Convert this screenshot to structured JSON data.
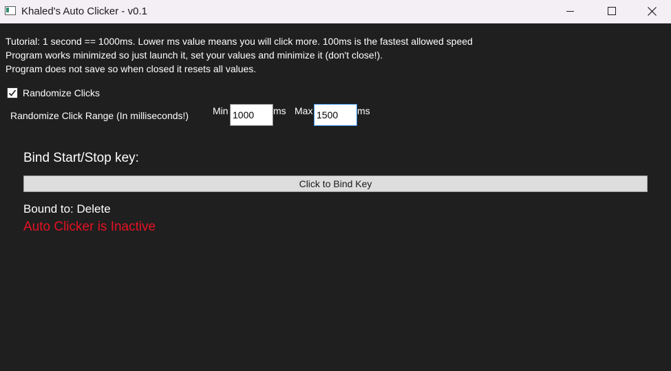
{
  "window": {
    "title": "Khaled's Auto Clicker - v0.1"
  },
  "tutorial": {
    "line1": "Tutorial: 1 second == 1000ms. Lower ms value means you will click more. 100ms is the fastest allowed speed",
    "line2": "Program works minimized so just launch it, set your values and minimize it (don't close!).",
    "line3": "Program does not save so when closed it resets all values."
  },
  "randomize": {
    "checkbox_label": "Randomize Clicks",
    "checked": true,
    "range_label": "Randomize Click Range (In milliseconds!)",
    "min_label": "Min",
    "min_value": "1000",
    "min_unit": "ms",
    "max_label": "Max",
    "max_value": "1500",
    "max_unit": "ms"
  },
  "bind": {
    "heading": "Bind Start/Stop key:",
    "button_label": "Click to Bind Key",
    "bound_to": "Bound to: Delete"
  },
  "status": {
    "text": "Auto Clicker is Inactive",
    "color": "#e81123"
  },
  "icons": {
    "app": "app-window-icon",
    "minimize": "minimize-icon",
    "maximize": "maximize-icon",
    "close": "close-icon",
    "check": "checkmark-icon"
  }
}
